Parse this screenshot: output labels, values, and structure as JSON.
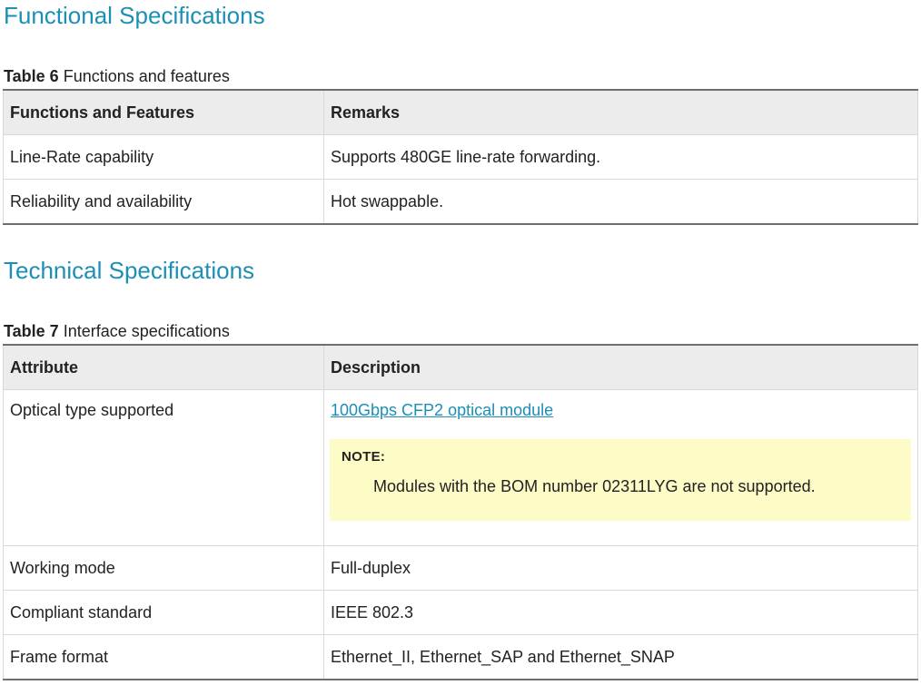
{
  "section1": {
    "title": "Functional Specifications",
    "table": {
      "caption_number": "Table 6",
      "caption_text": "Functions and features",
      "headers": [
        "Functions and Features",
        "Remarks"
      ],
      "rows": [
        [
          "Line-Rate capability",
          "Supports 480GE line-rate forwarding."
        ],
        [
          "Reliability and availability",
          "Hot swappable."
        ]
      ]
    }
  },
  "section2": {
    "title": "Technical Specifications",
    "table": {
      "caption_number": "Table 7",
      "caption_text": "Interface specifications",
      "headers": [
        "Attribute",
        "Description"
      ],
      "optical_row": {
        "attribute": "Optical type supported",
        "link_text": "100Gbps CFP2 optical module",
        "note_label": "NOTE:",
        "note_text": "Modules with the BOM number 02311LYG are not supported."
      },
      "rows": [
        [
          "Working mode",
          "Full-duplex"
        ],
        [
          "Compliant standard",
          "IEEE 802.3"
        ],
        [
          "Frame format",
          "Ethernet_II, Ethernet_SAP and Ethernet_SNAP"
        ]
      ]
    }
  },
  "colors": {
    "heading": "#1b8fb5",
    "link": "#1b8fb5",
    "note_background": "#fdfbc6",
    "header_background": "#ececec"
  }
}
